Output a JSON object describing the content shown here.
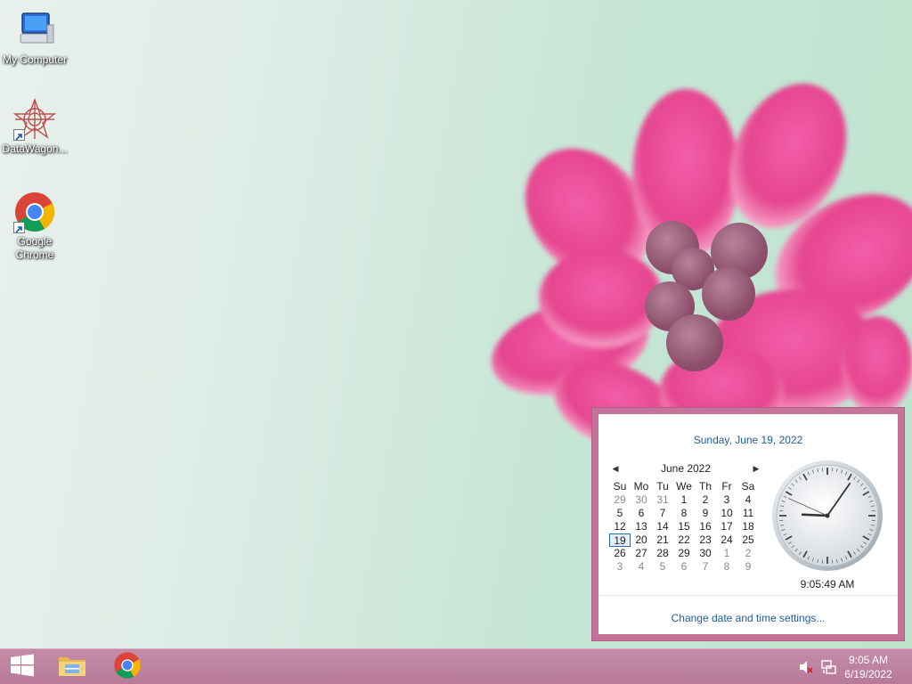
{
  "desktop": {
    "icons": [
      {
        "label": "My Computer",
        "icon": "computer-icon"
      },
      {
        "label": "DataWagon...",
        "icon": "datawagon-icon"
      },
      {
        "label": "Google Chrome",
        "icon": "chrome-icon"
      }
    ]
  },
  "flyout": {
    "long_date": "Sunday, June 19, 2022",
    "month_title": "June 2022",
    "prev_icon": "chevron-left-icon",
    "next_icon": "chevron-right-icon",
    "weekdays": [
      "Su",
      "Mo",
      "Tu",
      "We",
      "Th",
      "Fr",
      "Sa"
    ],
    "weeks": [
      [
        {
          "d": "29",
          "o": true
        },
        {
          "d": "30",
          "o": true
        },
        {
          "d": "31",
          "o": true
        },
        {
          "d": "1"
        },
        {
          "d": "2"
        },
        {
          "d": "3"
        },
        {
          "d": "4"
        }
      ],
      [
        {
          "d": "5"
        },
        {
          "d": "6"
        },
        {
          "d": "7"
        },
        {
          "d": "8"
        },
        {
          "d": "9"
        },
        {
          "d": "10"
        },
        {
          "d": "11"
        }
      ],
      [
        {
          "d": "12"
        },
        {
          "d": "13"
        },
        {
          "d": "14"
        },
        {
          "d": "15"
        },
        {
          "d": "16"
        },
        {
          "d": "17"
        },
        {
          "d": "18"
        }
      ],
      [
        {
          "d": "19",
          "today": true
        },
        {
          "d": "20"
        },
        {
          "d": "21"
        },
        {
          "d": "22"
        },
        {
          "d": "23"
        },
        {
          "d": "24"
        },
        {
          "d": "25"
        }
      ],
      [
        {
          "d": "26"
        },
        {
          "d": "27"
        },
        {
          "d": "28"
        },
        {
          "d": "29"
        },
        {
          "d": "30"
        },
        {
          "d": "1",
          "o": true
        },
        {
          "d": "2",
          "o": true
        }
      ],
      [
        {
          "d": "3",
          "o": true
        },
        {
          "d": "4",
          "o": true
        },
        {
          "d": "5",
          "o": true
        },
        {
          "d": "6",
          "o": true
        },
        {
          "d": "7",
          "o": true
        },
        {
          "d": "8",
          "o": true
        },
        {
          "d": "9",
          "o": true
        }
      ]
    ],
    "clock_time": "9:05:49 AM",
    "clock_hours": 9,
    "clock_minutes": 5,
    "clock_seconds": 49,
    "change_link": "Change date and time settings..."
  },
  "taskbar": {
    "start_icon": "windows-logo-icon",
    "pinned": [
      {
        "name": "file-explorer",
        "icon": "folder-icon"
      },
      {
        "name": "google-chrome",
        "icon": "chrome-icon"
      }
    ],
    "tray": {
      "volume_icon": "speaker-muted-icon",
      "network_icon": "network-icon",
      "time": "9:05 AM",
      "date": "6/19/2022"
    }
  },
  "colors": {
    "accent": "#c7729b",
    "taskbar": "#b97c9b",
    "link": "#1f5c99"
  }
}
